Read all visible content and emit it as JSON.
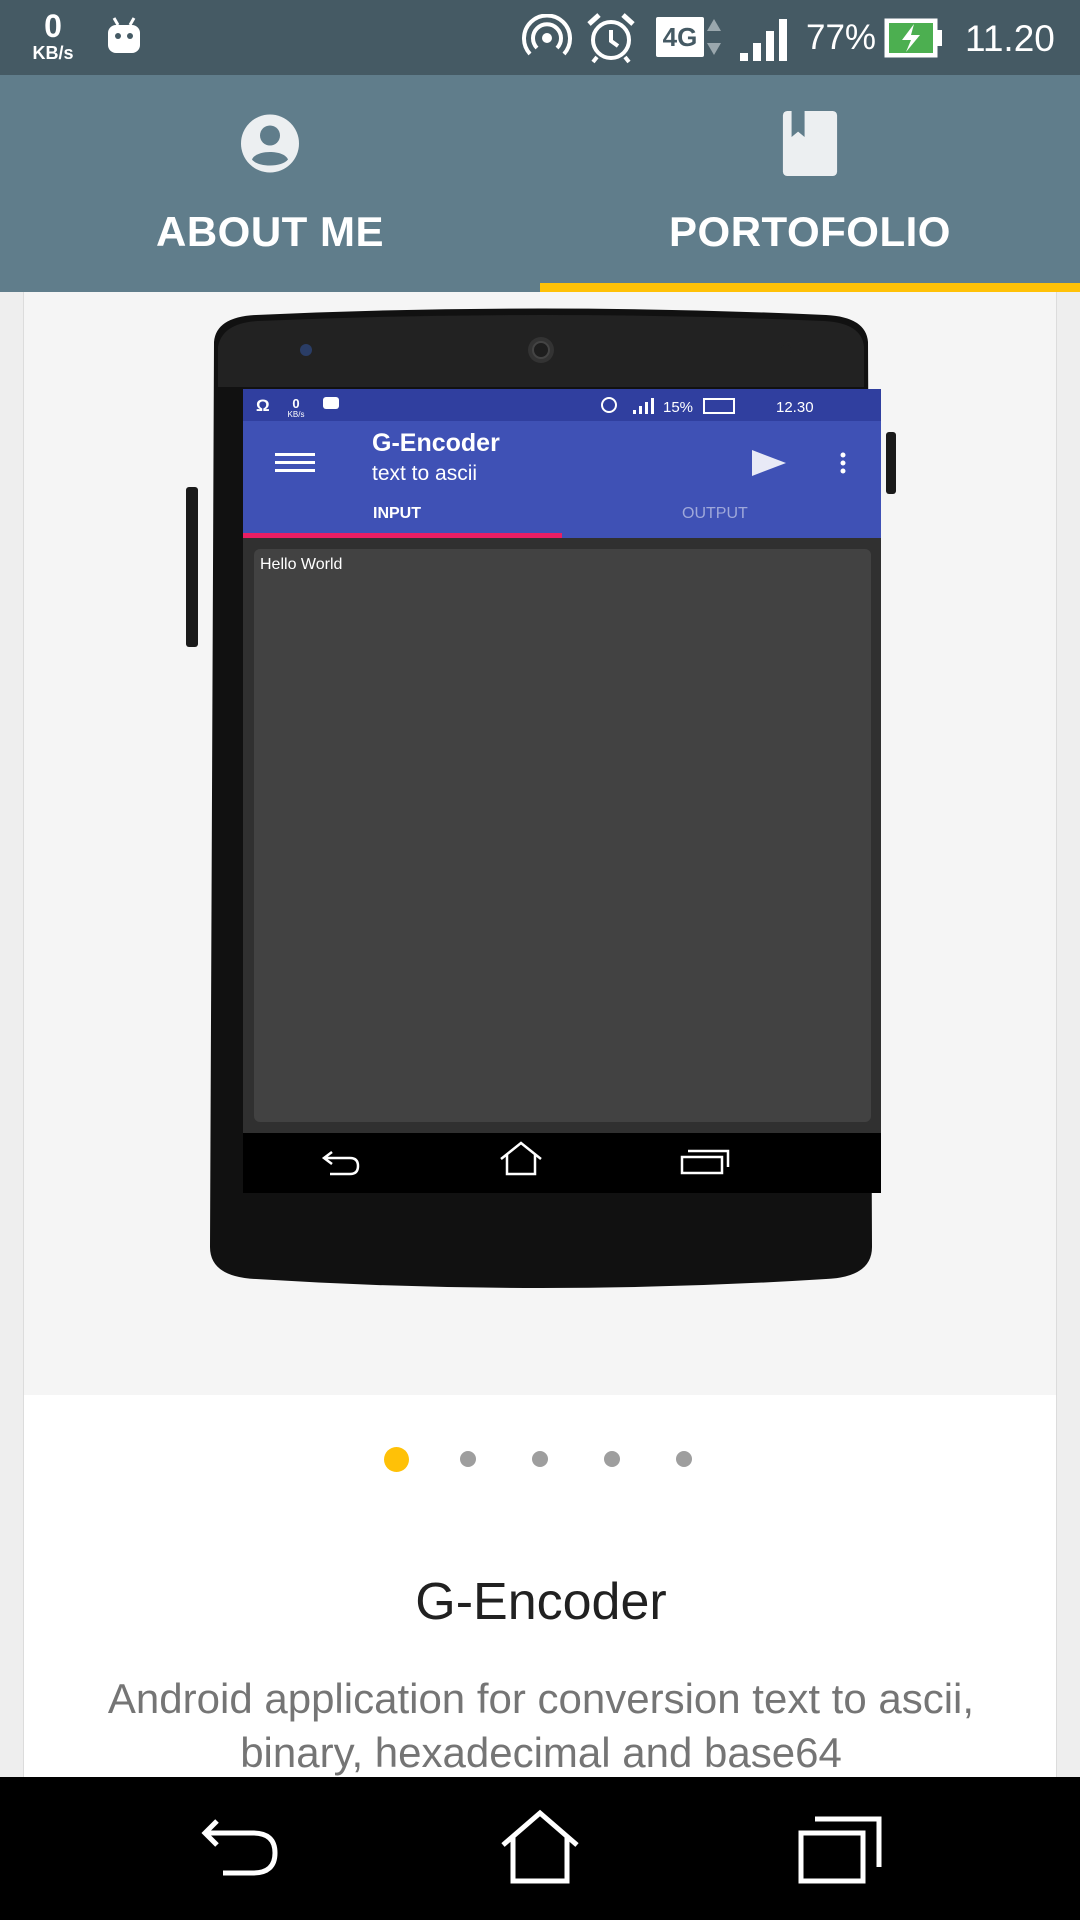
{
  "status_bar": {
    "net_speed_value": "0",
    "net_speed_unit": "KB/s",
    "network_type": "4G",
    "battery_percent": "77%",
    "time": "11.20",
    "icons": [
      "android-icon",
      "hotspot-icon",
      "alarm-icon",
      "data-arrows-icon",
      "signal-icon",
      "battery-charging-icon"
    ]
  },
  "tabs": [
    {
      "label": "ABOUT ME",
      "icon": "account-circle-icon",
      "selected": false
    },
    {
      "label": "PORTOFOLIO",
      "icon": "book-icon",
      "selected": true
    }
  ],
  "colors": {
    "status_bar": "#455a64",
    "tab_bar": "#607d8b",
    "tab_indicator": "#ffc107",
    "active_dot": "#ffc107",
    "inactive_dot": "#9e9e9e"
  },
  "carousel": {
    "slide_count": 5,
    "active_index": 0,
    "screenshot": {
      "status_speed_value": "0",
      "status_speed_unit": "KB/s",
      "status_battery": "15%",
      "status_time": "12.30",
      "app_title": "G-Encoder",
      "app_subtitle": "text to ascii",
      "tab_input": "INPUT",
      "tab_output": "OUTPUT",
      "input_text": "Hello World"
    }
  },
  "project": {
    "title": "G-Encoder",
    "description": "Android application for conversion text to ascii, binary, hexadecimal and base64"
  },
  "nav_bar": {
    "buttons": [
      "back-icon",
      "home-icon",
      "recents-icon"
    ]
  }
}
